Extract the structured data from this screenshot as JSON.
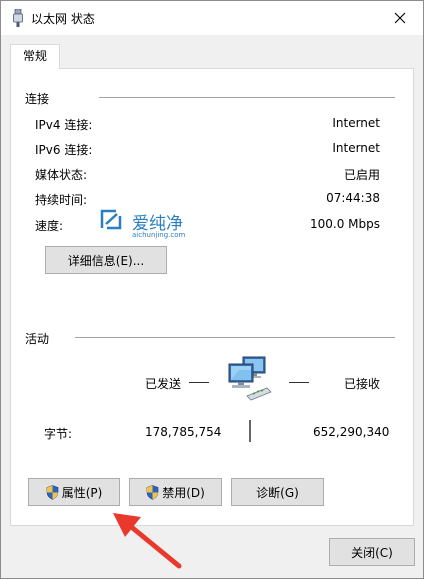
{
  "window": {
    "title": "以太网 状态"
  },
  "tabs": [
    {
      "label": "常规"
    }
  ],
  "connection": {
    "header": "连接",
    "rows": [
      {
        "label": "IPv4 连接:",
        "value": "Internet"
      },
      {
        "label": "IPv6 连接:",
        "value": "Internet"
      },
      {
        "label": "媒体状态:",
        "value": "已启用"
      },
      {
        "label": "持续时间:",
        "value": "07:44:38"
      },
      {
        "label": "速度:",
        "value": "100.0 Mbps"
      }
    ],
    "details_button": "详细信息(E)..."
  },
  "watermark": {
    "cn": "爱纯净",
    "en": "aichunjing.com"
  },
  "activity": {
    "header": "活动",
    "sent_label": "已发送",
    "received_label": "已接收",
    "bytes_label": "字节:",
    "bytes_sent": "178,785,754",
    "bytes_received": "652,290,340"
  },
  "buttons": {
    "properties": "属性(P)",
    "disable": "禁用(D)",
    "diagnose": "诊断(G)",
    "close": "关闭(C)"
  },
  "colors": {
    "watermark": "#2a7fc0",
    "arrow": "#e8392c",
    "button_face": "#e1e1e1"
  },
  "icons": {
    "title": "ethernet-plug-icon",
    "close": "close-icon",
    "shield": "uac-shield-icon",
    "network": "network-computers-icon"
  }
}
